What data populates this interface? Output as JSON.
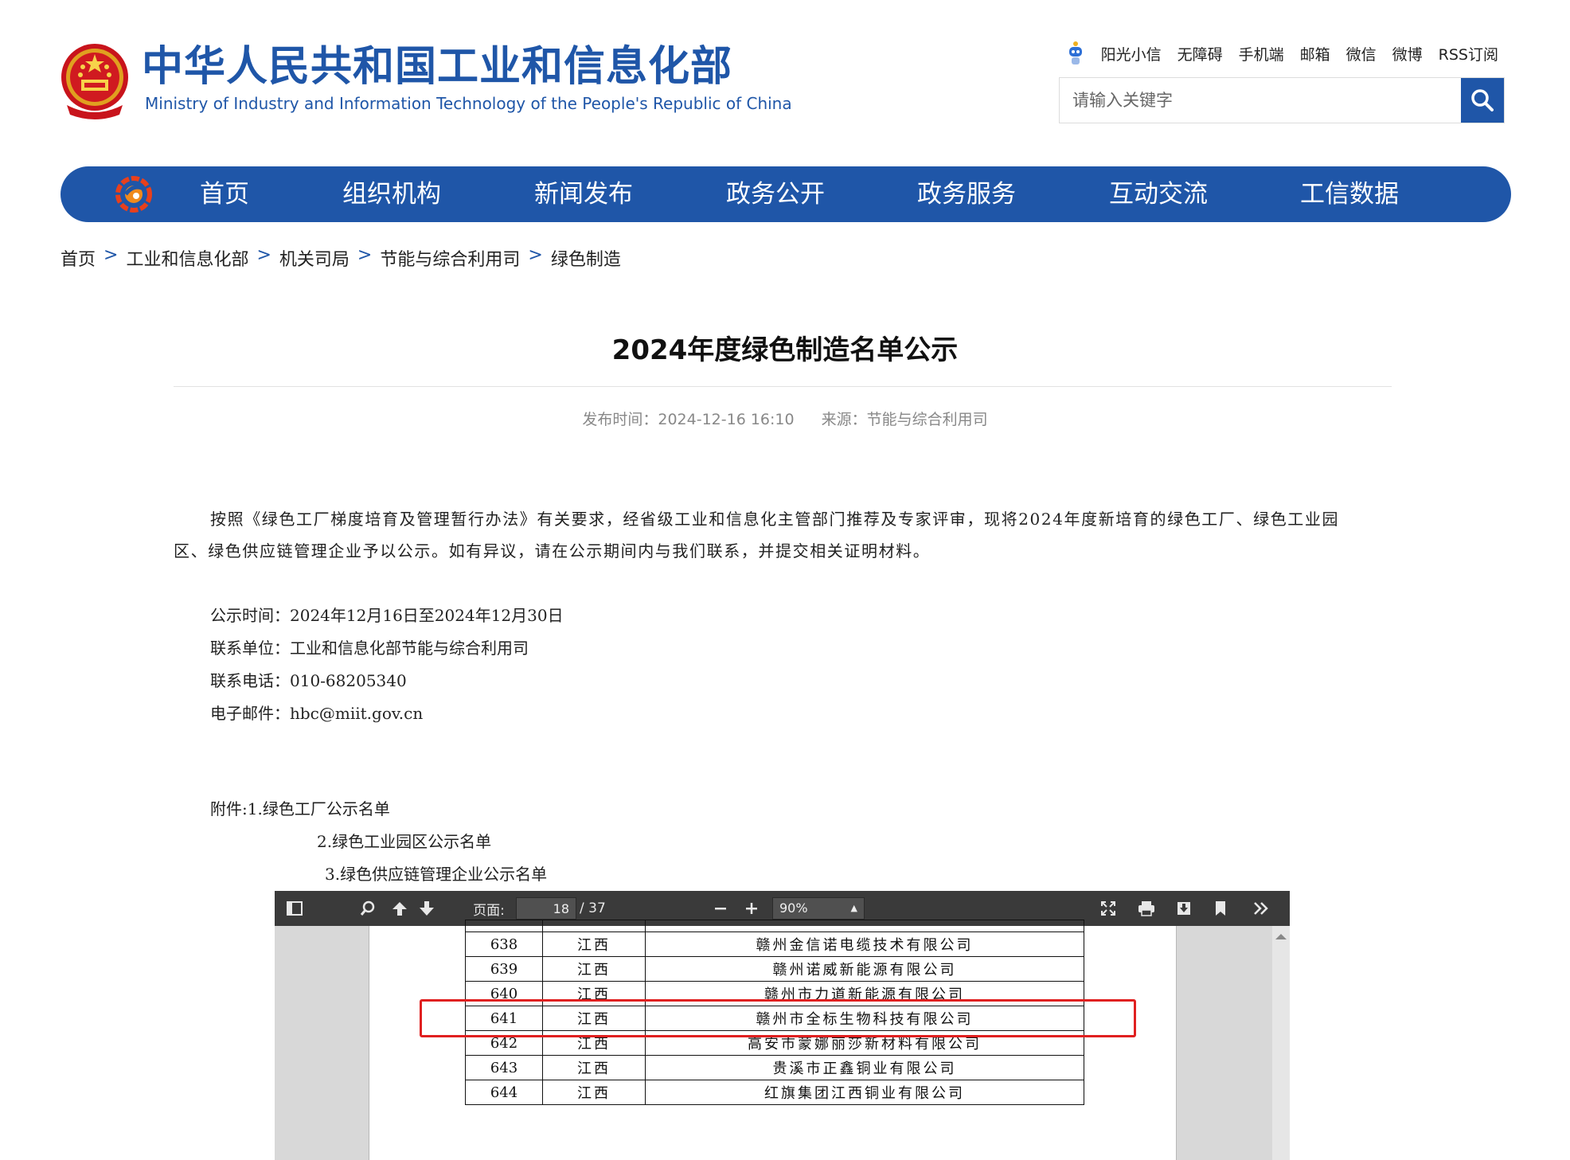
{
  "header": {
    "title_cn": "中华人民共和国工业和信息化部",
    "title_en": "Ministry of Industry and Information Technology of the People's Republic of China",
    "top_links": [
      "阳光小信",
      "无障碍",
      "手机端",
      "邮箱",
      "微信",
      "微博",
      "RSS订阅"
    ],
    "search_placeholder": "请输入关键字",
    "brand_color": "#1f56a8"
  },
  "nav": {
    "items": [
      "首页",
      "组织机构",
      "新闻发布",
      "政务公开",
      "政务服务",
      "互动交流",
      "工信数据"
    ]
  },
  "breadcrumb": [
    "首页",
    "工业和信息化部",
    "机关司局",
    "节能与综合利用司",
    "绿色制造"
  ],
  "article": {
    "title": "2024年度绿色制造名单公示",
    "publish_label": "发布时间：",
    "publish_time": "2024-12-16 16:10",
    "source_label": "来源：",
    "source": "节能与综合利用司",
    "paragraph_line1": "按照《绿色工厂梯度培育及管理暂行办法》有关要求，经省级工业和信息化主管部门推荐及专家评审，现将2024年度新培育的绿色工厂、绿色工业园",
    "paragraph_line2": "区、绿色供应链管理企业予以公示。如有异议，请在公示期间内与我们联系，并提交相关证明材料。",
    "info": [
      "公示时间：2024年12月16日至2024年12月30日",
      "联系单位：工业和信息化部节能与综合利用司",
      "联系电话：010-68205340",
      "电子邮件：hbc@miit.gov.cn"
    ],
    "attachments": [
      "附件:1.绿色工厂公示名单",
      "2.绿色工业园区公示名单",
      "3.绿色供应链管理企业公示名单"
    ]
  },
  "pdf_viewer": {
    "page_label": "页面:",
    "current_page": "18",
    "total_pages": "/ 37",
    "zoom": "90%",
    "rows": [
      {
        "no": "638",
        "province": "江西",
        "company": "赣州金信诺电缆技术有限公司"
      },
      {
        "no": "639",
        "province": "江西",
        "company": "赣州诺威新能源有限公司"
      },
      {
        "no": "640",
        "province": "江西",
        "company": "赣州市力道新能源有限公司"
      },
      {
        "no": "641",
        "province": "江西",
        "company": "赣州市全标生物科技有限公司"
      },
      {
        "no": "642",
        "province": "江西",
        "company": "高安市蒙娜丽莎新材料有限公司"
      },
      {
        "no": "643",
        "province": "江西",
        "company": "贵溪市正鑫铜业有限公司"
      },
      {
        "no": "644",
        "province": "江西",
        "company": "红旗集团江西铜业有限公司"
      }
    ],
    "highlighted_row": "641",
    "highlight_color": "#e02020"
  }
}
